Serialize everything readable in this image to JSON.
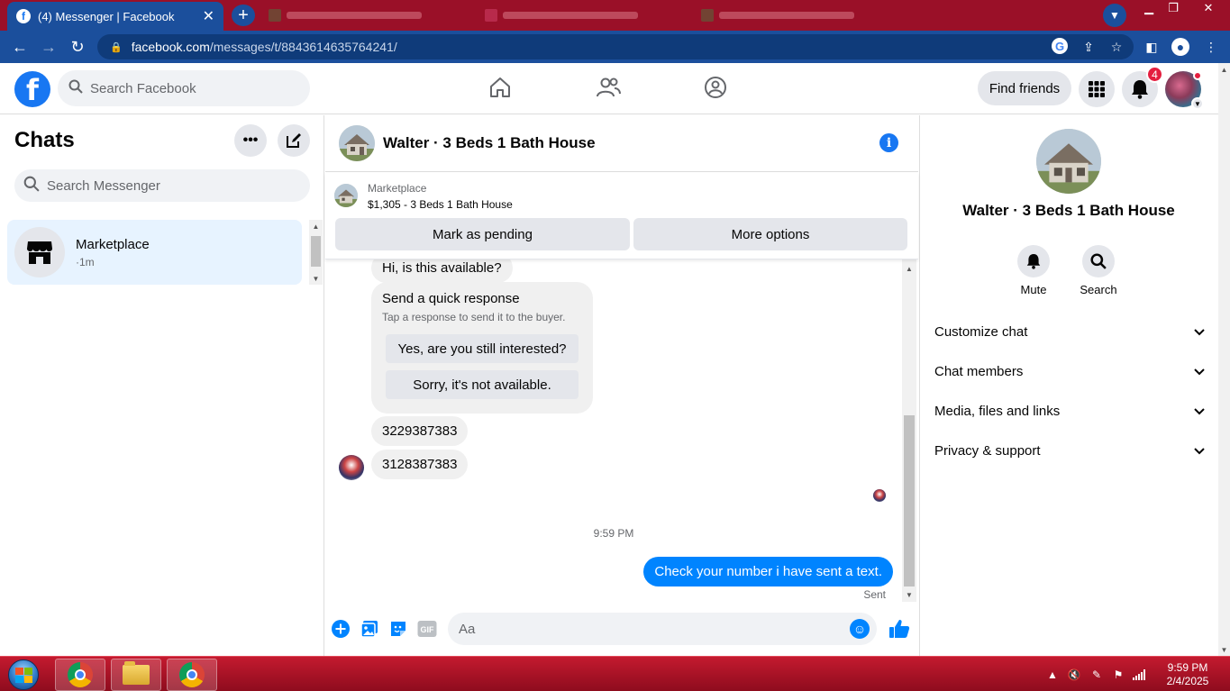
{
  "browser": {
    "tab_title": "(4) Messenger | Facebook",
    "url_host": "facebook.com",
    "url_path": "/messages/t/8843614635764241/"
  },
  "fb_header": {
    "search_placeholder": "Search Facebook",
    "find_friends_label": "Find friends",
    "notification_count": "4"
  },
  "chats": {
    "title": "Chats",
    "search_placeholder": "Search Messenger",
    "items": [
      {
        "name": "Marketplace",
        "subtitle": "·1m"
      }
    ]
  },
  "conversation": {
    "name": "Walter · 3 Beds 1 Bath House",
    "listing": {
      "source": "Marketplace",
      "title": "$1,305 - 3 Beds 1 Bath House",
      "mark_pending_label": "Mark as pending",
      "more_options_label": "More options"
    },
    "messages": {
      "first_in": "Hi, is this available?",
      "quick_response_title": "Send a quick response",
      "quick_response_sub": "Tap a response to send it to the buyer.",
      "quick_responses": [
        "Yes, are you still interested?",
        "Sorry, it's not available."
      ],
      "in_1": "3229387383",
      "in_2": "3128387383",
      "timestamp": "9:59 PM",
      "out_1": "Check your number i have sent a text.",
      "status": "Sent"
    },
    "composer_placeholder": "Aa"
  },
  "details": {
    "name": "Walter · 3 Beds 1 Bath House",
    "actions": [
      "Mute",
      "Search"
    ],
    "sections": [
      "Customize chat",
      "Chat members",
      "Media, files and links",
      "Privacy & support"
    ]
  },
  "taskbar": {
    "time": "9:59 PM",
    "date": "2/4/2025"
  },
  "colors": {
    "fb_blue": "#1877f2",
    "messenger_blue": "#0084ff",
    "chrome_tabbar": "#9a1028",
    "chrome_toolbar": "#1b4f9c",
    "selected_chat": "#e7f3ff"
  }
}
